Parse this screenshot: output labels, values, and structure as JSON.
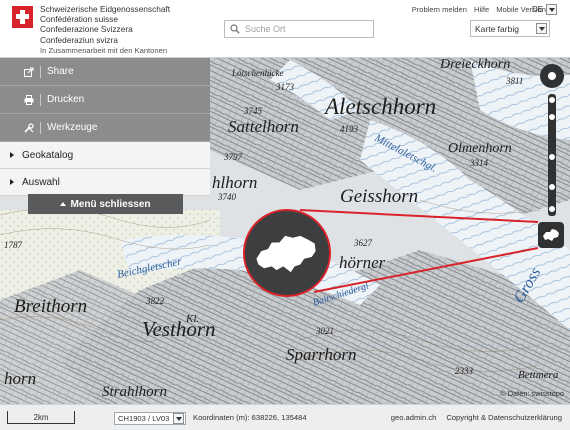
{
  "header": {
    "confederation_names": [
      "Schweizerische Eidgenossenschaft",
      "Confédération suisse",
      "Confederazione Svizzera",
      "Confederaziun svizra"
    ],
    "subtitle": "In Zusammenarbeit mit den Kantonen",
    "links": [
      "Problem melden",
      "Hilfe",
      "Mobile Version"
    ],
    "language": "DE",
    "search_placeholder": "Suche Ort",
    "background_layer": "Karte farbig"
  },
  "menu": {
    "tools": [
      {
        "label": "Share",
        "icon": "share-icon"
      },
      {
        "label": "Drucken",
        "icon": "printer-icon"
      },
      {
        "label": "Werkzeuge",
        "icon": "tools-icon"
      }
    ],
    "sections": [
      "Geokatalog",
      "Auswahl"
    ],
    "close_label": "Menü schliessen"
  },
  "map": {
    "labels": [
      "Lötschenlücke",
      "3173",
      "3745",
      "Sattelhorn",
      "Aletschhorn",
      "Dreieckhorn",
      "3811",
      "4193",
      "Olmenhorn",
      "3314",
      "Mittelaletschgl.",
      "3797",
      "Geisshorn",
      "3740",
      "3627",
      "Beichgletscher",
      "Breithorn",
      "3822",
      "Vesthorn",
      "Sparrhorn",
      "3021",
      "Strahlhorn",
      "1787",
      "2333",
      "Bettmera",
      "Gross",
      "horn",
      "hörner",
      "hlhorn",
      "Kl.",
      "Baltschiedergl"
    ],
    "attribution": "© Daten: swisstopo",
    "overview_icon": "switzerland-map-icon"
  },
  "controls": {
    "rotate_icon": "compass-icon",
    "zoom_icon": "zoom-slider-icon",
    "overview_toggle_icon": "switzerland-icon"
  },
  "footer": {
    "scale": "2km",
    "crs": "CH1903 / LV03",
    "coordinates": "Koordinaten (m): 638226, 135484",
    "links": [
      "geo.admin.ch",
      "Copyright & Datenschutzerklärung"
    ]
  },
  "colors": {
    "swiss_red": "#d8232a",
    "menu_tool_bg": "#8b8c8e",
    "menu_button_dark": "#585a5c",
    "glacier_blue": "#8fb2d6",
    "loupe_dark": "#3c3e40"
  }
}
